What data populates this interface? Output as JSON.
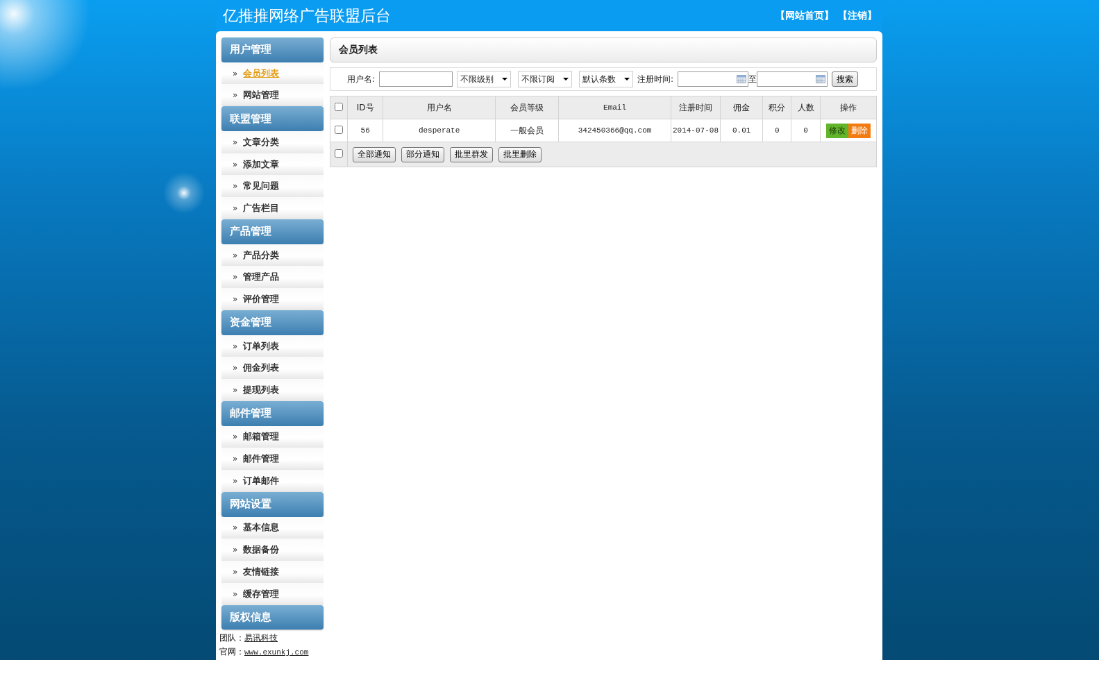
{
  "header": {
    "title": "亿推推网络广告联盟后台",
    "links": [
      "【网站首页】",
      "【注销】"
    ]
  },
  "sidebar": {
    "sections": [
      {
        "title": "用户管理",
        "items": [
          {
            "label": "会员列表",
            "selected": true
          },
          {
            "label": "网站管理",
            "selected": false
          }
        ]
      },
      {
        "title": "联盟管理",
        "items": [
          {
            "label": "文章分类",
            "selected": false
          },
          {
            "label": "添加文章",
            "selected": false
          },
          {
            "label": "常见问题",
            "selected": false
          },
          {
            "label": "广告栏目",
            "selected": false
          }
        ]
      },
      {
        "title": "产品管理",
        "items": [
          {
            "label": "产品分类",
            "selected": false
          },
          {
            "label": "管理产品",
            "selected": false
          },
          {
            "label": "评价管理",
            "selected": false
          }
        ]
      },
      {
        "title": "资金管理",
        "items": [
          {
            "label": "订单列表",
            "selected": false
          },
          {
            "label": "佣金列表",
            "selected": false
          },
          {
            "label": "提现列表",
            "selected": false
          }
        ]
      },
      {
        "title": "邮件管理",
        "items": [
          {
            "label": "邮箱管理",
            "selected": false
          },
          {
            "label": "邮件管理",
            "selected": false
          },
          {
            "label": "订单邮件",
            "selected": false
          }
        ]
      },
      {
        "title": "网站设置",
        "items": [
          {
            "label": "基本信息",
            "selected": false
          },
          {
            "label": "数据备份",
            "selected": false
          },
          {
            "label": "友情链接",
            "selected": false
          },
          {
            "label": "缓存管理",
            "selected": false
          }
        ]
      },
      {
        "title": "版权信息"
      }
    ],
    "bullet": "»",
    "credits": [
      {
        "kind": "name",
        "label": "团队：",
        "link": "易讯科技"
      },
      {
        "kind": "url",
        "label": "官网：",
        "link": "www.exunkj.com"
      }
    ]
  },
  "panel": {
    "title": "会员列表"
  },
  "filter": {
    "username_label": "用户名:",
    "selects": [
      "不限级别",
      "不限订阅",
      "默认条数"
    ],
    "date_label": "注册时间:",
    "to_label": "至",
    "search_button": "搜索"
  },
  "table": {
    "select_all_checked": false,
    "columns": [
      "ID号",
      "用户名",
      "会员等级",
      "Email",
      "注册时间",
      "佣金",
      "积分",
      "人数",
      "操作"
    ],
    "rows": [
      {
        "checked": false,
        "cells": [
          "56",
          "desperate",
          "一般会员",
          "342450366@qq.com",
          "2014-07-08",
          "0.01",
          "0",
          "0"
        ],
        "actions": [
          "修改",
          "删除"
        ]
      }
    ],
    "footer": {
      "checked": false,
      "buttons": [
        "全部通知",
        "部分通知",
        "批里群发",
        "批里删除"
      ]
    }
  }
}
